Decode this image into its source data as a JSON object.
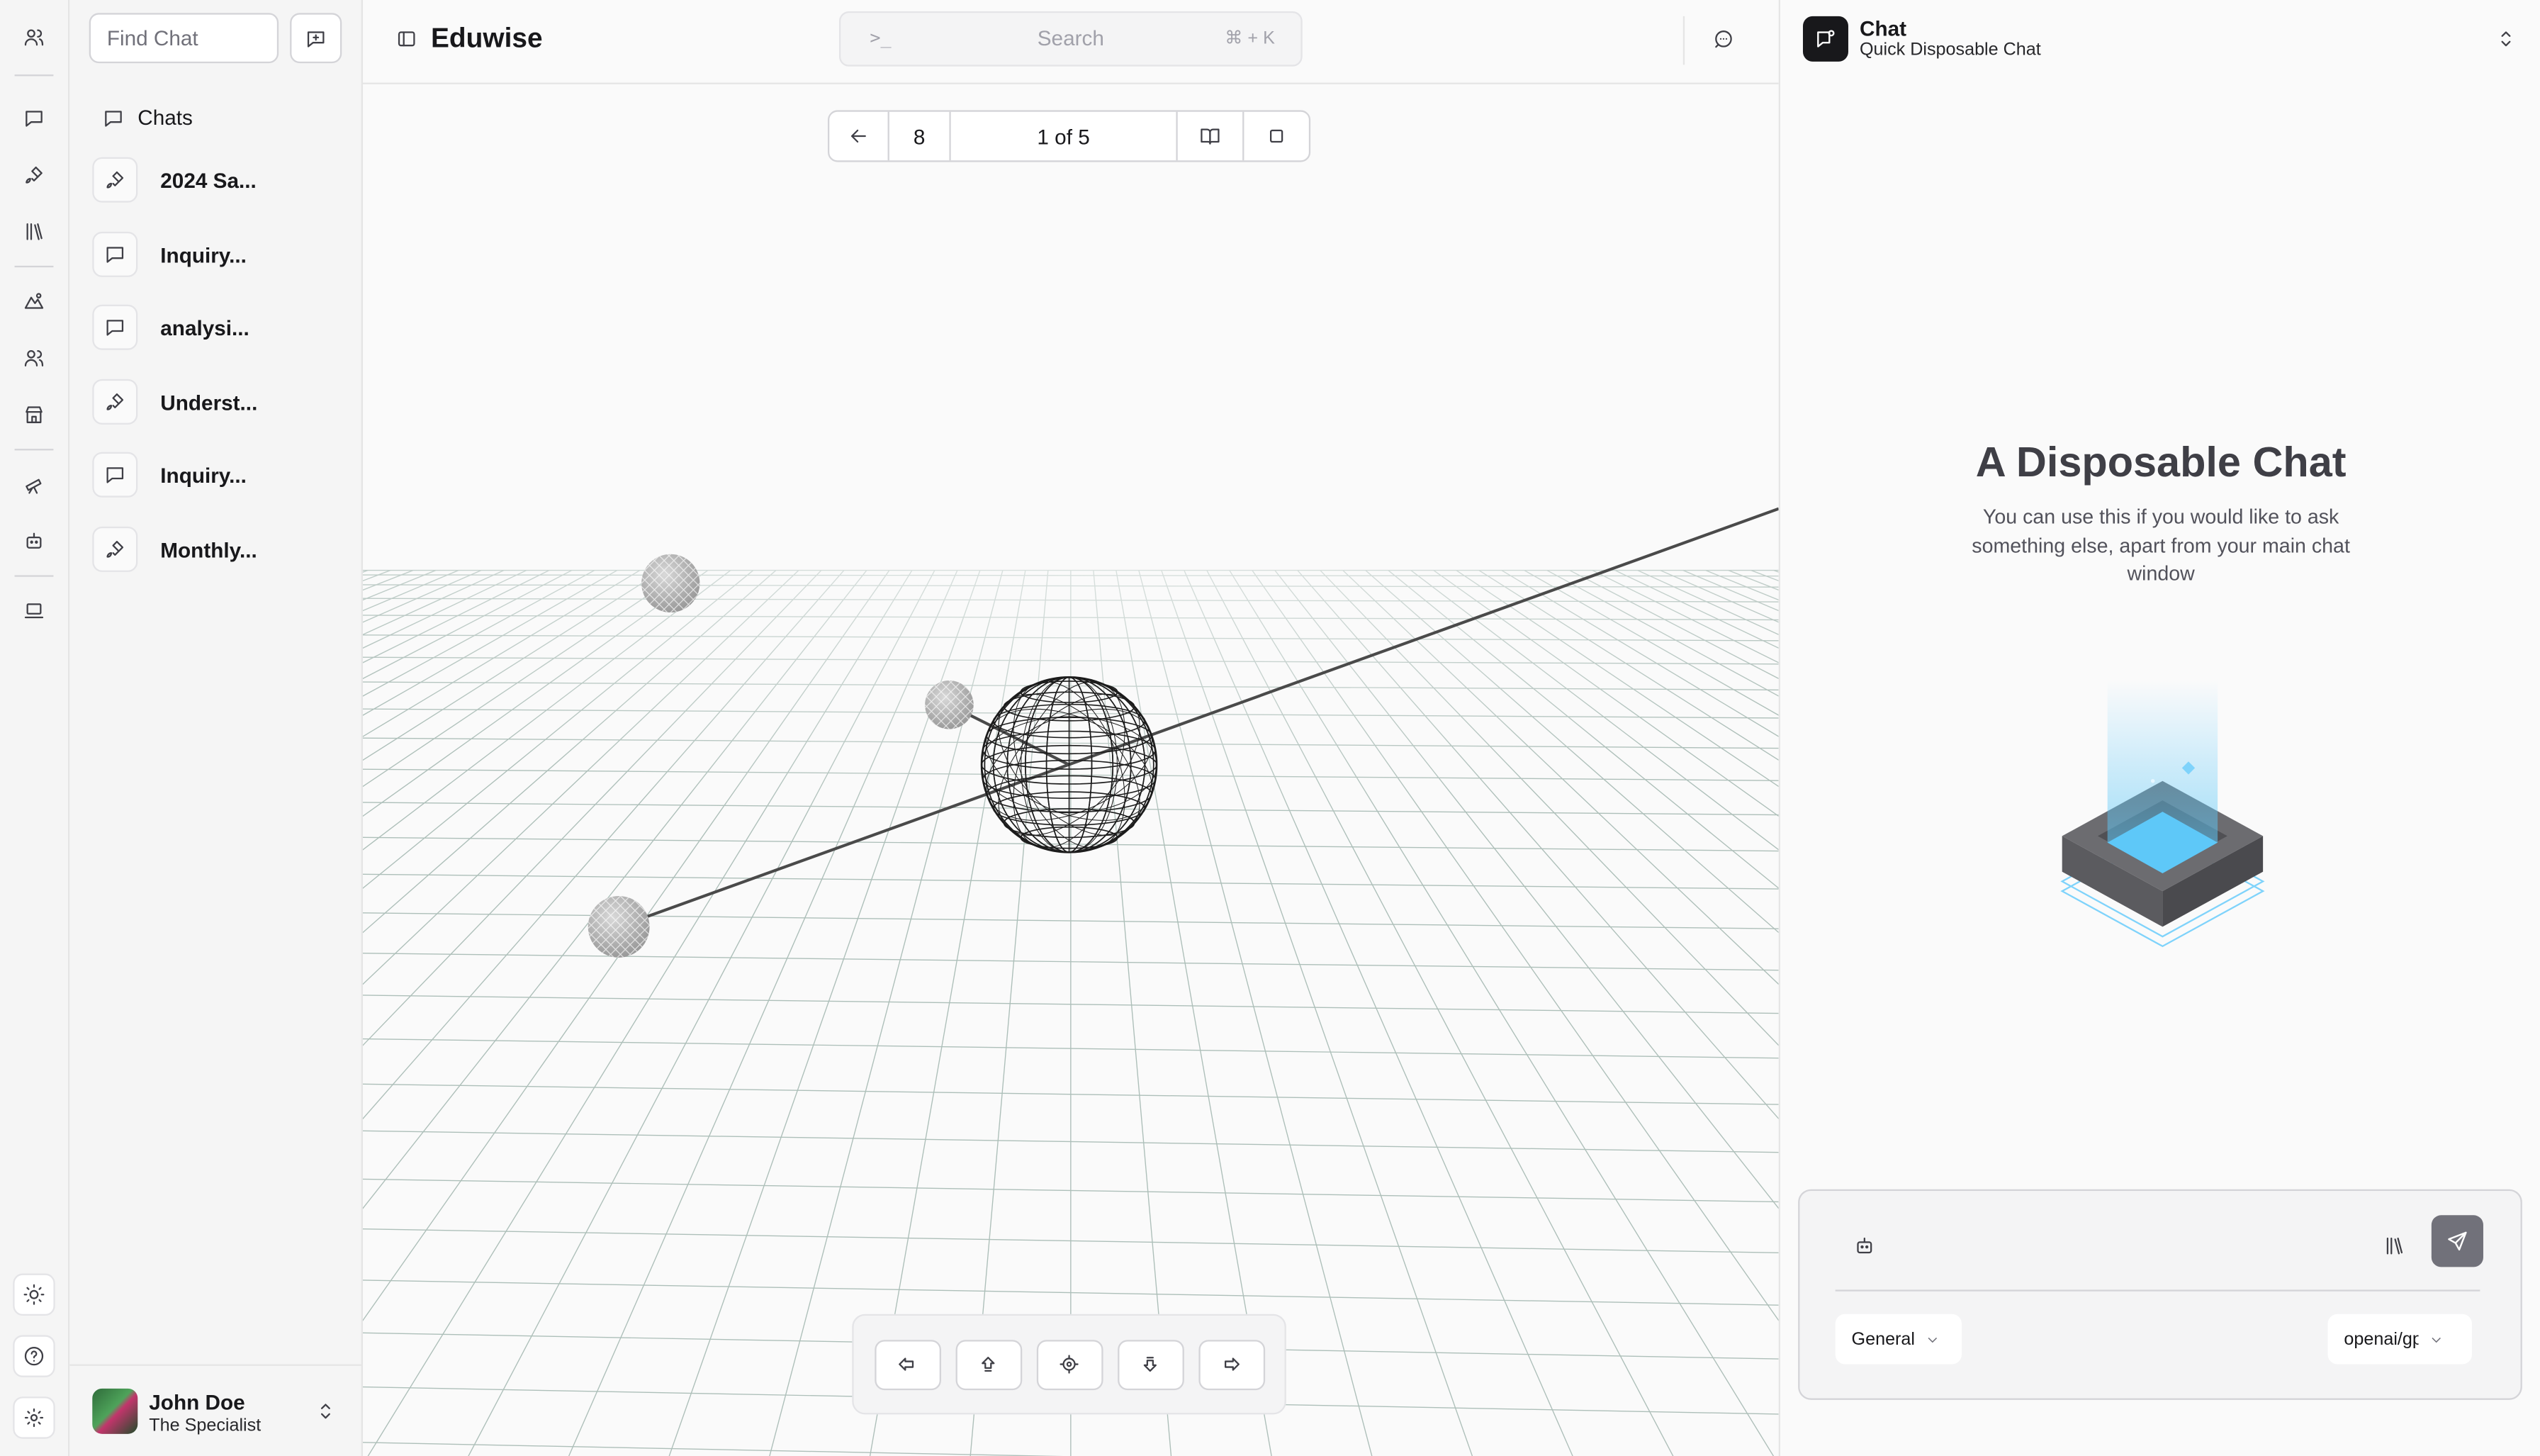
{
  "rail": {
    "items": [
      {
        "name": "users-icon"
      },
      {
        "name": "chat-icon"
      },
      {
        "name": "brush-icon"
      },
      {
        "name": "library-icon"
      },
      {
        "name": "map-icon"
      },
      {
        "name": "team-icon"
      },
      {
        "name": "store-icon"
      },
      {
        "name": "telescope-icon"
      },
      {
        "name": "bot-icon"
      },
      {
        "name": "laptop-icon"
      }
    ],
    "bottom": [
      {
        "name": "theme-icon"
      },
      {
        "name": "help-icon"
      },
      {
        "name": "settings-icon"
      }
    ]
  },
  "sidebar": {
    "search_placeholder": "Find Chat",
    "chats_heading": "Chats",
    "chats": [
      {
        "label": "2024 Sa...",
        "icon": "brush-icon"
      },
      {
        "label": "Inquiry...",
        "icon": "chat-icon"
      },
      {
        "label": "analysi...",
        "icon": "chat-icon"
      },
      {
        "label": "Underst...",
        "icon": "brush-icon"
      },
      {
        "label": "Inquiry...",
        "icon": "chat-icon"
      },
      {
        "label": "Monthly...",
        "icon": "brush-icon"
      }
    ],
    "user": {
      "name": "John Doe",
      "role": "The Specialist"
    }
  },
  "header": {
    "title": "Eduwise",
    "search": {
      "prompt": ">_",
      "placeholder": "Search",
      "shortcut": "⌘ + K"
    }
  },
  "pager": {
    "count": "8",
    "position": "1 of 5"
  },
  "nav_controls": [
    {
      "name": "arrow-left-icon"
    },
    {
      "name": "arrow-up-icon"
    },
    {
      "name": "recenter-icon"
    },
    {
      "name": "arrow-down-icon"
    },
    {
      "name": "arrow-right-icon"
    }
  ],
  "panel": {
    "title": "Chat",
    "subtitle": "Quick Disposable Chat",
    "hero_title": "A Disposable Chat",
    "hero_text": "You can use this if you would like to ask something else, apart from your main chat window",
    "mode": "General",
    "model": "openai/gpt"
  },
  "colors": {
    "accent": "#18181b",
    "illustration_blue": "#5ec8f8",
    "send_button": "#71717a"
  }
}
